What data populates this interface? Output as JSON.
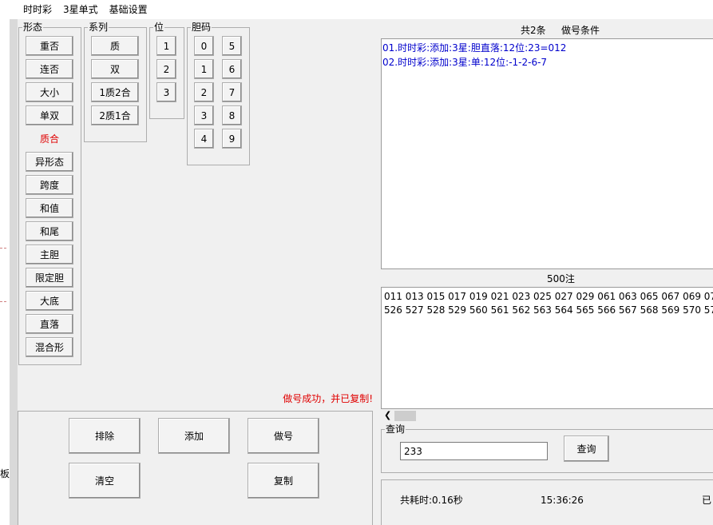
{
  "menu": [
    "时时彩",
    "3星单式",
    "基础设置"
  ],
  "left_edge_label": "板",
  "groups": {
    "xingtai": {
      "label": "形态",
      "items": [
        "重否",
        "连否",
        "大小",
        "单双",
        "质合",
        "异形态",
        "跨度",
        "和值",
        "和尾",
        "主胆",
        "限定胆",
        "大底",
        "直落",
        "混合形"
      ],
      "active_item": "质合",
      "active_color": "#e00000"
    },
    "xilie": {
      "label": "系列",
      "items": [
        "质",
        "双",
        "1质2合",
        "2质1合"
      ]
    },
    "wei": {
      "label": "位",
      "items": [
        "1",
        "2",
        "3"
      ]
    },
    "danma": {
      "label": "胆码",
      "col1": [
        "0",
        "1",
        "2",
        "3",
        "4"
      ],
      "col2": [
        "5",
        "6",
        "7",
        "8",
        "9"
      ]
    }
  },
  "status_message": "做号成功，并已复制!",
  "actions": {
    "exclude": "排除",
    "add": "添加",
    "make": "做号",
    "clear": "清空",
    "copy": "复制"
  },
  "conditions": {
    "count_label": "共2条",
    "title": "做号条件",
    "items": [
      "01.时时彩:添加:3星:胆直落:12位:23=012",
      "02.时时彩:添加:3星:单:12位:-1-2-6-7"
    ]
  },
  "results": {
    "count_label": "500注",
    "lines": [
      "011 013 015 017 019 021 023 025 027 029 061 063 065 067 069 071 07",
      "526 527 528 529 560 561 562 563 564 565 566 567 568 569 570 571 57"
    ]
  },
  "query": {
    "label": "查询",
    "value": "233",
    "button": "查询"
  },
  "footer": {
    "elapsed": "共耗时:0.16秒",
    "time": "15:36:26",
    "cut_text": "已"
  }
}
